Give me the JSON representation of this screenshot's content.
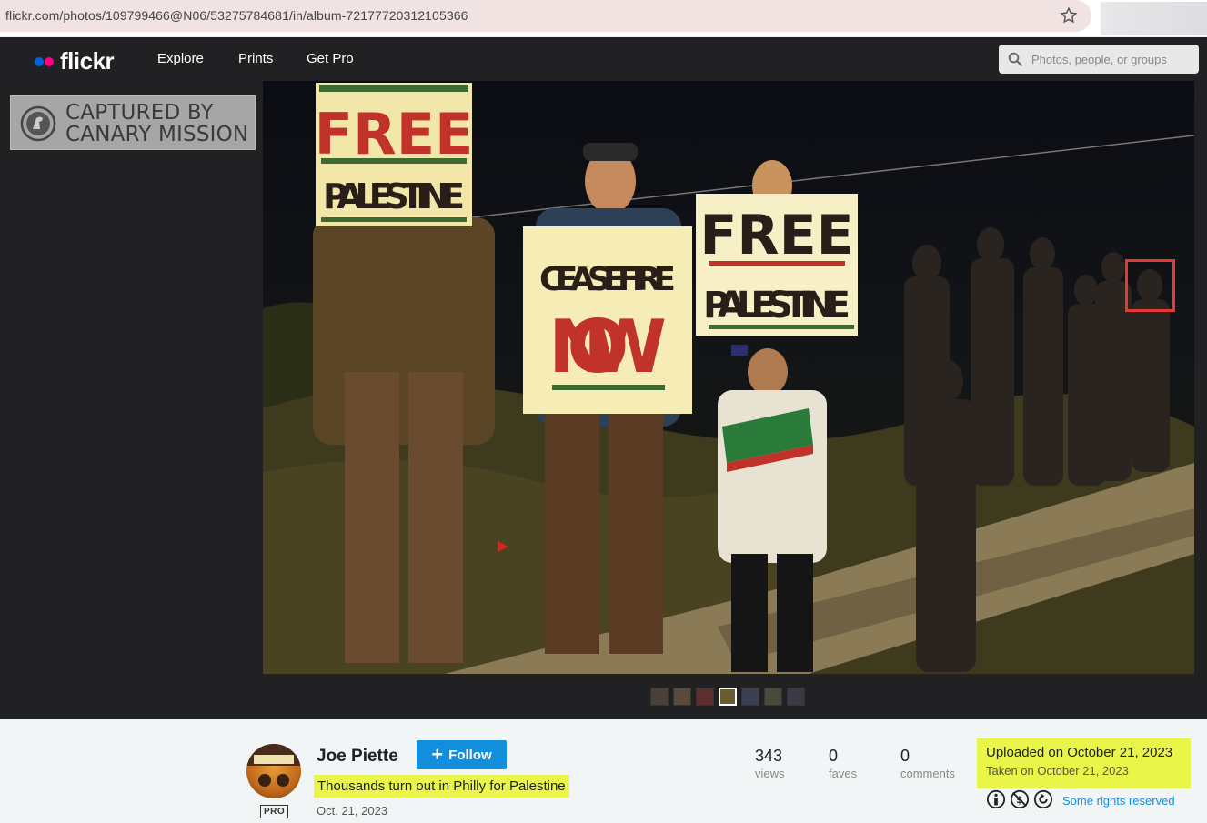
{
  "browser": {
    "url": "flickr.com/photos/109799466@N06/53275784681/in/album-72177720312105366"
  },
  "nav": {
    "logo": "flickr",
    "links": [
      "Explore",
      "Prints",
      "Get Pro"
    ],
    "search_placeholder": "Photos, people, or groups"
  },
  "watermark": {
    "line1": "CAPTURED BY",
    "line2": "CANARY MISSION"
  },
  "photo": {
    "signs": [
      "FREE",
      "PALESTINE",
      "CEASEFIRE",
      "NOW",
      "FREE",
      "PALESTINE"
    ],
    "thumbnail_count": 7,
    "active_thumbnail": 4
  },
  "info": {
    "owner": "Joe Piette",
    "follow_label": "Follow",
    "pro_label": "PRO",
    "title": "Thousands turn out in Philly for Palestine",
    "date": "Oct. 21, 2023",
    "stats": [
      {
        "value": "343",
        "label": "views"
      },
      {
        "value": "0",
        "label": "faves"
      },
      {
        "value": "0",
        "label": "comments"
      }
    ],
    "uploaded": "Uploaded on October 21, 2023",
    "taken": "Taken on October 21, 2023",
    "rights": "Some rights reserved"
  },
  "colors": {
    "accent_blue": "#128fdc",
    "highlight": "#eaf54a",
    "face_box": "#e53935"
  }
}
